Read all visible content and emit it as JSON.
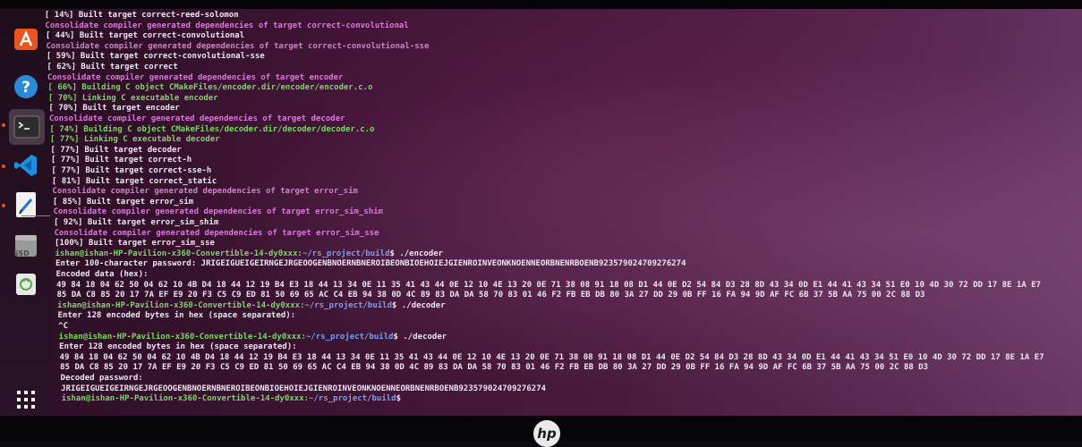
{
  "dock": {
    "items": [
      {
        "name": "software-center-icon",
        "color": "#e95420"
      },
      {
        "name": "help-icon",
        "color": "#2b8ad8"
      },
      {
        "name": "terminal-icon",
        "color": "#3a3a3a"
      },
      {
        "name": "vscode-icon",
        "color": "#1e8fe0"
      },
      {
        "name": "text-editor-icon",
        "color": "#f2f2f2"
      },
      {
        "name": "ssd-drive-icon",
        "label": "SSD",
        "color": "#9a9a9a"
      },
      {
        "name": "trash-icon",
        "color": "#e8e8e8"
      },
      {
        "name": "show-apps-icon",
        "color": "#ffffff"
      }
    ]
  },
  "terminal": {
    "lines": [
      {
        "style": "white",
        "text": "[ 14%] Built target correct-reed-solomon"
      },
      {
        "style": "magenta",
        "text": "Consolidate compiler generated dependencies of target correct-convolutional"
      },
      {
        "style": "white",
        "text": "[ 44%] Built target correct-convolutional"
      },
      {
        "style": "magenta",
        "text": "Consolidate compiler generated dependencies of target correct-convolutional-sse"
      },
      {
        "style": "white",
        "text": "[ 59%] Built target correct-convolutional-sse"
      },
      {
        "style": "white",
        "text": "[ 62%] Built target correct"
      },
      {
        "style": "magenta",
        "text": "Consolidate compiler generated dependencies of target encoder"
      },
      {
        "style": "green",
        "text": "[ 66%] Building C object CMakeFiles/encoder.dir/encoder/encoder.c.o"
      },
      {
        "style": "green",
        "text": "[ 70%] Linking C executable encoder"
      },
      {
        "style": "white",
        "text": "[ 70%] Built target encoder"
      },
      {
        "style": "magenta",
        "text": "Consolidate compiler generated dependencies of target decoder"
      },
      {
        "style": "green",
        "text": "[ 74%] Building C object CMakeFiles/decoder.dir/decoder/decoder.c.o"
      },
      {
        "style": "green",
        "text": "[ 77%] Linking C executable decoder"
      },
      {
        "style": "white",
        "text": "[ 77%] Built target decoder"
      },
      {
        "style": "white",
        "text": "[ 77%] Built target correct-h"
      },
      {
        "style": "white",
        "text": "[ 77%] Built target correct-sse-h"
      },
      {
        "style": "white",
        "text": "[ 81%] Built target correct_static"
      },
      {
        "style": "magenta",
        "text": "Consolidate compiler generated dependencies of target error_sim"
      },
      {
        "style": "white",
        "text": "[ 85%] Built target error_sim"
      },
      {
        "style": "magenta",
        "text": "Consolidate compiler generated dependencies of target error_sim_shim"
      },
      {
        "style": "white",
        "text": "[ 92%] Built target error_sim_shim"
      },
      {
        "style": "magenta",
        "text": "Consolidate compiler generated dependencies of target error_sim_sse"
      },
      {
        "style": "white",
        "text": "[100%] Built target error_sim_sse"
      },
      {
        "style": "prompt",
        "user": "ishan@ishan-HP-Pavilion-x360-Convertible-14-dy0xxx",
        "path": "~/rs_project/build",
        "cmd": "$ ./encoder"
      },
      {
        "style": "white",
        "text": "Enter 100-character password: JRIGEIGUEIGEIRNGEJRGEOOGENBNOERNBNEROIBEONBIOEHOIEJGIENROINVEONKNOENNEORBNENRBOENB923579024709276274"
      },
      {
        "style": "white",
        "text": "Encoded data (hex):"
      },
      {
        "style": "white",
        "text": "49 84 18 04 62 50 04 62 10 4B D4 18 44 12 19 B4 E3 18 44 13 34 0E 11 35 41 43 44 0E 12 10 4E 13 20 0E 71 38 08 91 18 08 D1 44 0E D2 54 84 D3 28 8D 43 34 0D E1 44 41 43 34 51 E0 10 4D 30 72 DD 17 8E 1A E7"
      },
      {
        "style": "white",
        "text": "85 DA C8 85 20 17 7A EF E9 20 F3 C5 C9 ED 81 50 69 65 AC C4 EB 94 38 0D 4C 89 83 DA DA 58 70 83 01 46 F2 FB EB DB 80 3A 27 DD 29 0B FF 16 FA 94 9D AF FC 6B 37 5B AA 75 00 2C 88 D3"
      },
      {
        "style": "prompt",
        "user": "ishan@ishan-HP-Pavilion-x360-Convertible-14-dy0xxx",
        "path": "~/rs_project/build",
        "cmd": "$ ./decoder"
      },
      {
        "style": "white",
        "text": "Enter 128 encoded bytes in hex (space separated):"
      },
      {
        "style": "white",
        "text": "^C"
      },
      {
        "style": "prompt",
        "user": "ishan@ishan-HP-Pavilion-x360-Convertible-14-dy0xxx",
        "path": "~/rs_project/build",
        "cmd": "$ ./decoder"
      },
      {
        "style": "white",
        "text": "Enter 128 encoded bytes in hex (space separated):"
      },
      {
        "style": "white",
        "text": "49 84 18 04 62 50 04 62 10 4B D4 18 44 12 19 B4 E3 18 44 13 34 0E 11 35 41 43 44 0E 12 10 4E 13 20 0E 71 38 08 91 18 08 D1 44 0E D2 54 84 D3 28 8D 43 34 0D E1 44 41 43 34 51 E0 10 4D 30 72 DD 17 8E 1A E7"
      },
      {
        "style": "white",
        "text": "85 DA C8 85 20 17 7A EF E9 20 F3 C5 C9 ED 81 50 69 65 AC C4 EB 94 38 0D 4C 89 83 DA DA 58 70 83 01 46 F2 FB EB DB 80 3A 27 DD 29 0B FF 16 FA 94 9D AF FC 6B 37 5B AA 75 00 2C 88 D3"
      },
      {
        "style": "white",
        "text": "Decoded password:"
      },
      {
        "style": "white",
        "text": "JRIGEIGUEIGEIRNGEJRGEOOGENBNOERNBNEROIBEONBIOEHOIEJGIENROINVEONKNOENNEORBNENRBOENB923579024709276274"
      },
      {
        "style": "prompt",
        "user": "ishan@ishan-HP-Pavilion-x360-Convertible-14-dy0xxx",
        "path": "~/rs_project/build",
        "cmd": "$"
      }
    ]
  },
  "bezel": {
    "logo_text": "hp"
  },
  "colors": {
    "magenta": "#d77bd6",
    "green": "#7ed56a",
    "path": "#7c9ef0",
    "text": "#ece6ee"
  }
}
